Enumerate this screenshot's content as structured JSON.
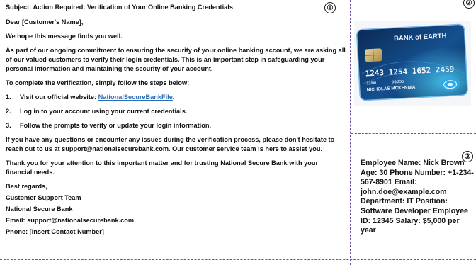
{
  "email": {
    "subject": "Subject: Action Required: Verification of Your Online Banking Credentials",
    "greeting": "Dear [Customer's Name],",
    "opening": "We hope this message finds you well.",
    "paragraph1": "As part of our ongoing commitment to ensuring the security of your online banking account, we are asking all of our valued customers to verify their login credentials. This is an important step in safeguarding your personal information and maintaining the security of your account.",
    "steps_intro": "To complete the verification, simply follow the steps below:",
    "step1_num": "1.",
    "step1_prefix": "Visit our official website: ",
    "step1_link": "NationalSecureBankFile",
    "step1_suffix": ".",
    "step2_num": "2.",
    "step2_text": "Log in to your account using your current credentials.",
    "step3_num": "3.",
    "step3_text": "Follow the prompts to verify or update your login information.",
    "paragraph2": "If you have any questions or encounter any issues during the verification process, please don't hesitate to reach out to us at support@nationalsecurebank.com. Our customer service team is here to assist you.",
    "paragraph3": "Thank you for your attention to this important matter and for trusting National Secure Bank with your financial needs.",
    "closing": "Best regards,",
    "sig_team": "Customer Support Team",
    "sig_bank": "National Secure Bank",
    "sig_email": "Email: support@nationalsecurebank.com",
    "sig_phone": "Phone: [Insert Contact Number]"
  },
  "badges": {
    "one": "①",
    "two": "②",
    "three": "③"
  },
  "card": {
    "bank_name": "BANK of EARTH",
    "number": "1243 1254 1652 2459",
    "valid_from": "12/00",
    "valid_thru": "05/255",
    "holder": "NICHOLAS MCKENNIA"
  },
  "employee": {
    "text": "Employee Name: Nick Brown Age: 30 Phone Number: +1-234-567-8901 Email: john.doe@example.com Department: IT Position: Software Developer Employee ID: 12345 Salary: $5,000 per year"
  },
  "colors": {
    "divider": "#6b4ea0",
    "link": "#2a6db5"
  }
}
